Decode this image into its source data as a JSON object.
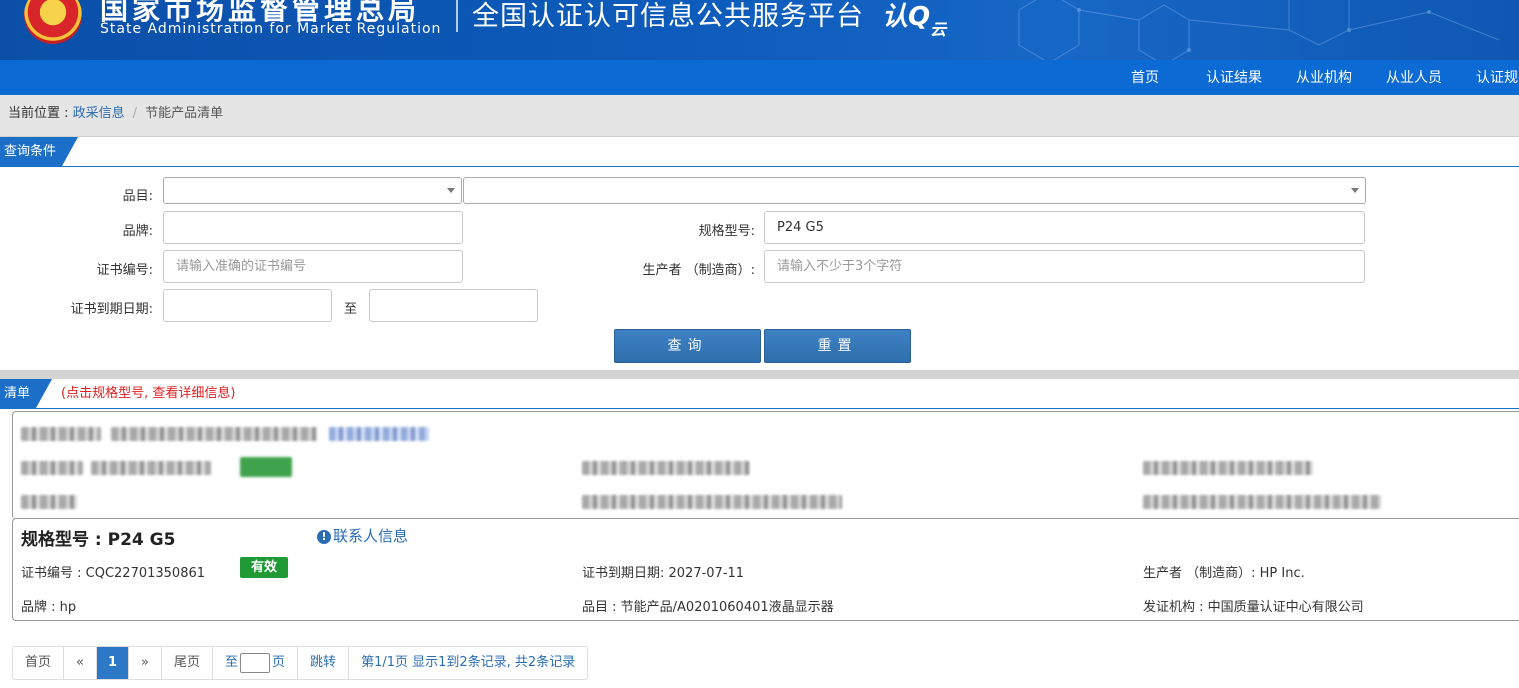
{
  "header": {
    "org_cn": "国家市场监督管理总局",
    "org_en": "State Administration  for  Market Regulation",
    "platform": "全国认证认可信息公共服务平台",
    "logo_main": "认Q",
    "logo_sub": "云"
  },
  "nav": {
    "items": [
      "首页",
      "认证结果",
      "从业机构",
      "从业人员",
      "认证规"
    ]
  },
  "breadcrumb": {
    "prefix": "当前位置 : ",
    "link": "政采信息",
    "separator": "/",
    "current": "节能产品清单"
  },
  "query": {
    "section_title": "查询条件",
    "category_label": "品目:",
    "brand_label": "品牌:",
    "brand_value": "",
    "model_label": "规格型号:",
    "model_value": "P24 G5",
    "cert_no_label": "证书编号:",
    "cert_no_placeholder": "请输入准确的证书编号",
    "manufacturer_label": "生产者 （制造商）:",
    "manufacturer_placeholder": "请输入不少于3个字符",
    "expiry_label": "证书到期日期:",
    "expiry_to": "至",
    "search_button": "查询",
    "reset_button": "重置"
  },
  "list": {
    "section_title": "清单",
    "note": "(点击规格型号, 查看详细信息)",
    "result": {
      "model_title": "规格型号 : P24 G5",
      "contact_link": "联系人信息",
      "contact_icon": "info-circle-icon",
      "cert_no": "证书编号 : CQC22701350861",
      "status": "有效",
      "expiry": "证书到期日期: 2027-07-11",
      "manufacturer": "生产者 （制造商）: HP Inc.",
      "brand": "品牌 : hp",
      "category": "品目 : 节能产品/A0201060401液晶显示器",
      "issuer": "发证机构 : 中国质量认证中心有限公司"
    }
  },
  "pagination": {
    "first": "首页",
    "prev": "«",
    "current": "1",
    "next": "»",
    "last": "尾页",
    "goto_prefix": "至",
    "goto_suffix": "页",
    "jump": "跳转",
    "summary": "第1/1页  显示1到2条记录, 共2条记录"
  },
  "colors": {
    "banner": "#0d5bbb",
    "nav": "#0c6ad4",
    "section_tab": "#1b6fc8",
    "status_valid": "#1f9a35",
    "link": "#2a6db3"
  }
}
